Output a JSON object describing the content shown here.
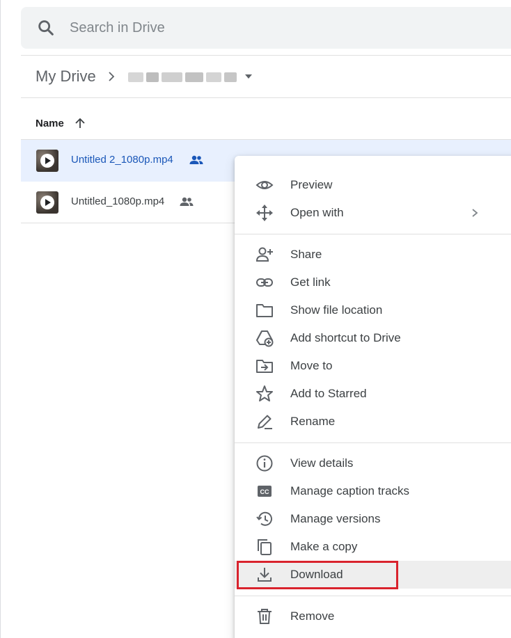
{
  "search": {
    "placeholder": "Search in Drive",
    "icon": "search-icon"
  },
  "breadcrumb": {
    "root": "My Drive"
  },
  "list": {
    "column_name": "Name",
    "files": [
      {
        "name": "Untitled 2_1080p.mp4",
        "selected": true,
        "shared": true
      },
      {
        "name": "Untitled_1080p.mp4",
        "selected": false,
        "shared": true
      }
    ]
  },
  "context_menu": {
    "items": [
      {
        "label": "Preview",
        "icon": "eye-icon"
      },
      {
        "label": "Open with",
        "icon": "move-arrows-icon",
        "has_submenu": true
      },
      {
        "label": "Share",
        "icon": "person-add-icon"
      },
      {
        "label": "Get link",
        "icon": "link-icon"
      },
      {
        "label": "Show file location",
        "icon": "folder-icon"
      },
      {
        "label": "Add shortcut to Drive",
        "icon": "drive-shortcut-icon"
      },
      {
        "label": "Move to",
        "icon": "move-to-folder-icon"
      },
      {
        "label": "Add to Starred",
        "icon": "star-icon"
      },
      {
        "label": "Rename",
        "icon": "pencil-icon"
      },
      {
        "label": "View details",
        "icon": "info-icon"
      },
      {
        "label": "Manage caption tracks",
        "icon": "cc-icon"
      },
      {
        "label": "Manage versions",
        "icon": "history-icon"
      },
      {
        "label": "Make a copy",
        "icon": "copy-icon"
      },
      {
        "label": "Download",
        "icon": "download-icon",
        "highlighted": true
      },
      {
        "label": "Remove",
        "icon": "trash-icon"
      }
    ]
  },
  "colors": {
    "selected_row_bg": "#e8f0fe",
    "selected_text": "#1a57b8",
    "highlight_box": "#d9232d",
    "hover_bg": "#eeeeee"
  }
}
